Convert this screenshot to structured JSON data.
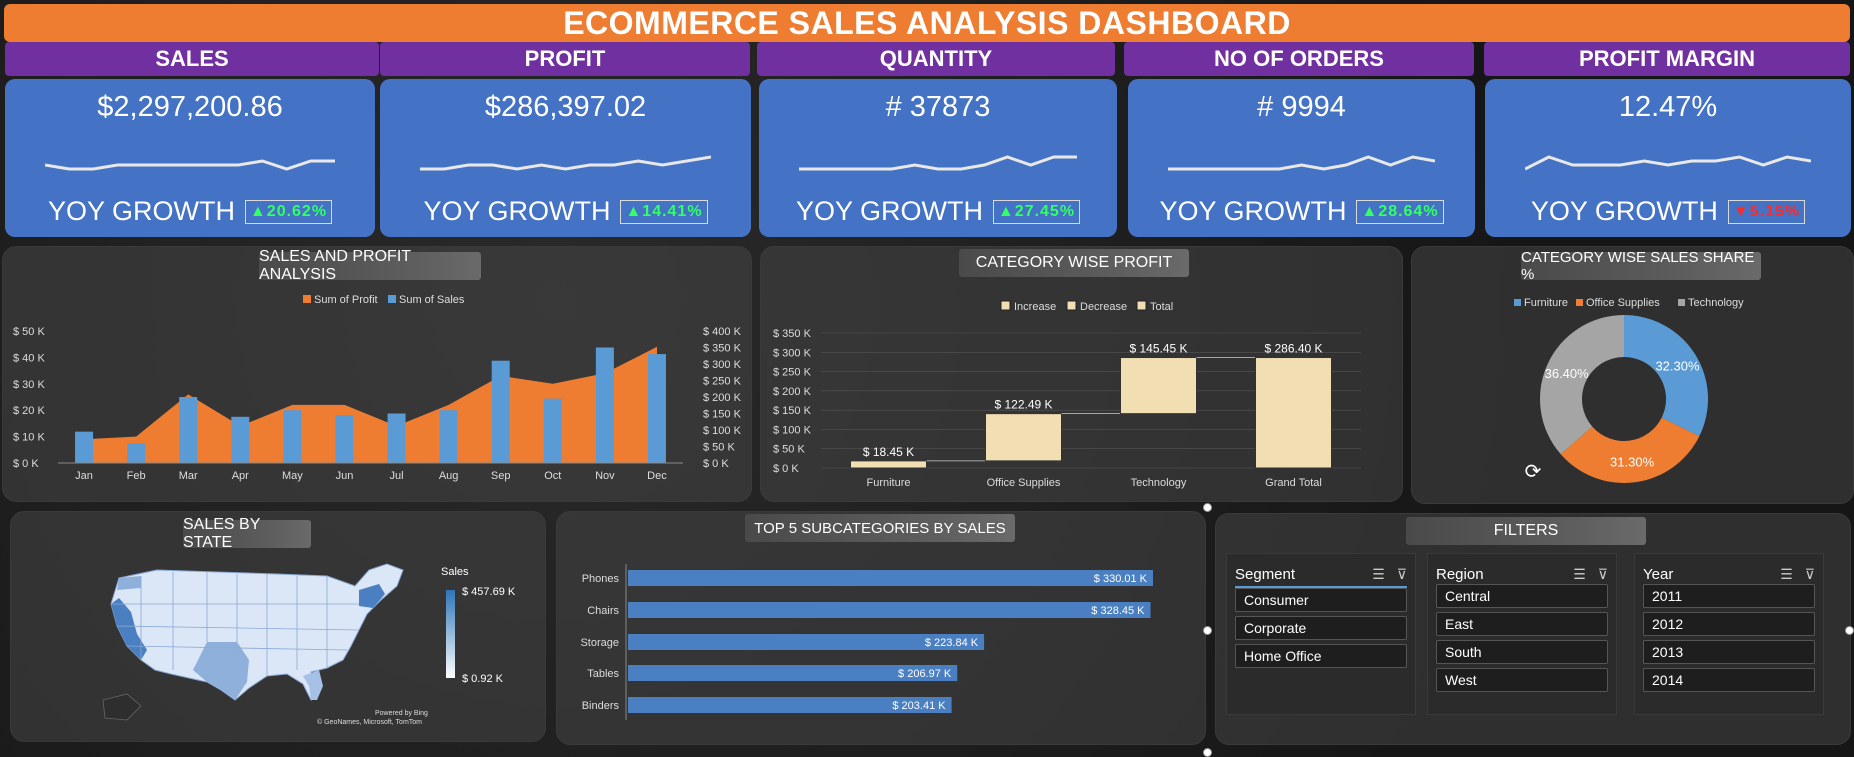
{
  "title": "ECOMMERCE SALES ANALYSIS DASHBOARD",
  "kpis": [
    {
      "head": "SALES",
      "value": "$2,297,200.86",
      "yoy_label": "YOY GROWTH",
      "badge": "▲20.62%",
      "dir": "up"
    },
    {
      "head": "PROFIT",
      "value": "$286,397.02",
      "yoy_label": "YOY GROWTH",
      "badge": "▲14.41%",
      "dir": "up"
    },
    {
      "head": "QUANTITY",
      "value": "# 37873",
      "yoy_label": "YOY GROWTH",
      "badge": "▲27.45%",
      "dir": "up"
    },
    {
      "head": "NO OF ORDERS",
      "value": "# 9994",
      "yoy_label": "YOY GROWTH",
      "badge": "▲28.64%",
      "dir": "up"
    },
    {
      "head": "PROFIT MARGIN",
      "value": "12.47%",
      "yoy_label": "YOY GROWTH",
      "badge": "▼5.15%",
      "dir": "down"
    }
  ],
  "panels": {
    "sales_profit": "SALES AND PROFIT ANALYSIS",
    "category_profit": "CATEGORY WISE PROFIT",
    "category_share": "CATEGORY WISE SALES SHARE %",
    "state": "SALES BY STATE",
    "top5": "TOP 5 SUBCATEGORIES BY SALES",
    "filters": "FILTERS"
  },
  "colors": {
    "orange": "#ee7d31",
    "blue": "#5b9bd5",
    "purple": "#7030a0",
    "card_blue": "#4472c4",
    "gray": "#a5a5a5",
    "tan": "#f2deb3"
  },
  "chart_data": [
    {
      "type": "bar",
      "title": "SALES AND PROFIT ANALYSIS",
      "categories": [
        "Jan",
        "Feb",
        "Mar",
        "Apr",
        "May",
        "Jun",
        "Jul",
        "Aug",
        "Sep",
        "Oct",
        "Nov",
        "Dec"
      ],
      "series": [
        {
          "name": "Sum of Profit",
          "type": "area",
          "axis": "left",
          "values": [
            9000,
            10000,
            26000,
            14000,
            22000,
            22000,
            14000,
            22000,
            33000,
            30000,
            34000,
            44000
          ]
        },
        {
          "name": "Sum of Sales",
          "type": "bar",
          "axis": "right",
          "values": [
            95000,
            60000,
            200000,
            140000,
            160000,
            145000,
            150000,
            160000,
            310000,
            195000,
            350000,
            330000
          ]
        }
      ],
      "y_left_ticks": [
        "$ 0 K",
        "$ 10 K",
        "$ 20 K",
        "$ 30 K",
        "$ 40 K",
        "$ 50 K"
      ],
      "y_right_ticks": [
        "$ 0 K",
        "$ 50 K",
        "$ 100 K",
        "$ 150 K",
        "$ 200 K",
        "$ 250 K",
        "$ 300 K",
        "$ 350 K",
        "$ 400 K"
      ],
      "ylim_left": [
        0,
        50000
      ],
      "ylim_right": [
        0,
        400000
      ],
      "legend": "top"
    },
    {
      "type": "bar",
      "title": "CATEGORY WISE PROFIT",
      "subtype": "waterfall",
      "categories": [
        "Furniture",
        "Office Supplies",
        "Technology",
        "Grand Total"
      ],
      "values": [
        18.45,
        122.49,
        145.45,
        286.4
      ],
      "labels": [
        "$ 18.45 K",
        "$ 122.49 K",
        "$ 145.45 K",
        "$ 286.40 K"
      ],
      "legend_entries": [
        "Increase",
        "Decrease",
        "Total"
      ],
      "y_ticks": [
        "$ 0 K",
        "$ 50 K",
        "$ 100 K",
        "$ 150 K",
        "$ 200 K",
        "$ 250 K",
        "$ 300 K",
        "$ 350 K"
      ],
      "ylim": [
        0,
        350
      ]
    },
    {
      "type": "pie",
      "title": "CATEGORY WISE SALES SHARE %",
      "subtype": "donut",
      "labels": [
        "Furniture",
        "Office Supplies",
        "Technology"
      ],
      "values": [
        32.3,
        31.3,
        36.4
      ],
      "value_labels": [
        "32.30%",
        "31.30%",
        "36.40%"
      ],
      "colors": [
        "#5b9bd5",
        "#ee7d31",
        "#a5a5a5"
      ],
      "legend": "top"
    },
    {
      "type": "bar",
      "title": "TOP 5 SUBCATEGORIES BY SALES",
      "orientation": "horizontal",
      "categories": [
        "Phones",
        "Chairs",
        "Storage",
        "Tables",
        "Binders"
      ],
      "values": [
        330.01,
        328.45,
        223.84,
        206.97,
        203.41
      ],
      "labels": [
        "$ 330.01 K",
        "$ 328.45 K",
        "$ 223.84 K",
        "$ 206.97 K",
        "$ 203.41 K"
      ]
    }
  ],
  "map": {
    "legend_title": "Sales",
    "legend_max": "$ 457.69 K",
    "legend_min": "$ 0.92 K",
    "credit_1": "Powered by Bing",
    "credit_2": "© GeoNames, Microsoft, TomTom"
  },
  "filters": {
    "segment": {
      "label": "Segment",
      "items": [
        "Consumer",
        "Corporate",
        "Home Office"
      ]
    },
    "region": {
      "label": "Region",
      "items": [
        "Central",
        "East",
        "South",
        "West"
      ]
    },
    "year": {
      "label": "Year",
      "items": [
        "2011",
        "2012",
        "2013",
        "2014"
      ]
    }
  }
}
